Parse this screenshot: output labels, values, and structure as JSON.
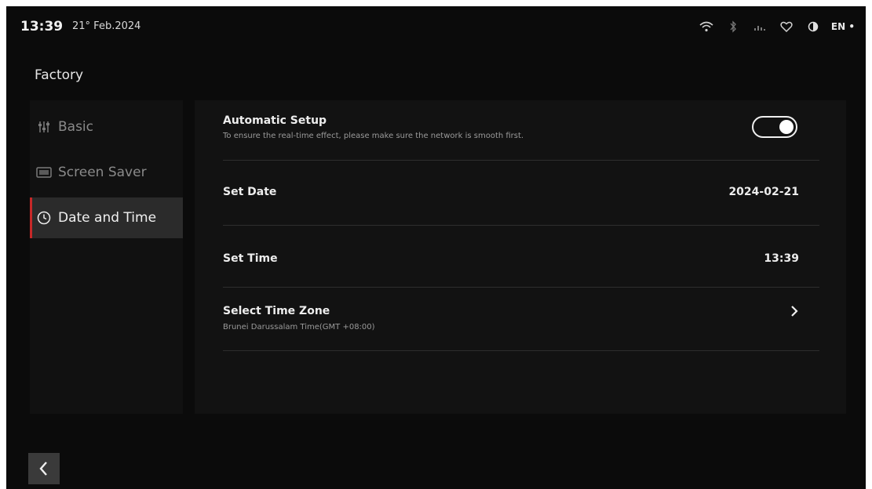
{
  "status_bar": {
    "time": "13:39",
    "date": "21° Feb.2024",
    "language": "EN",
    "icons": [
      "wifi-icon",
      "bluetooth-icon",
      "signal-icon",
      "heart-icon",
      "contrast-icon"
    ]
  },
  "page": {
    "title": "Factory"
  },
  "sidebar": {
    "items": [
      {
        "label": "Basic",
        "icon": "sliders-icon",
        "active": false
      },
      {
        "label": "Screen Saver",
        "icon": "screen-saver-icon",
        "active": false
      },
      {
        "label": "Date and Time",
        "icon": "clock-icon",
        "active": true
      }
    ]
  },
  "settings": {
    "automatic_setup": {
      "title": "Automatic Setup",
      "subtitle": "To ensure the real-time effect, please make sure the network is smooth first.",
      "enabled": true
    },
    "set_date": {
      "title": "Set Date",
      "value": "2024-02-21"
    },
    "set_time": {
      "title": "Set Time",
      "value": "13:39"
    },
    "time_zone": {
      "title": "Select Time Zone",
      "subtitle": "Brunei Darussalam Time(GMT +08:00)"
    }
  },
  "colors": {
    "background": "#0b0b0b",
    "panel": "#121212",
    "active_indicator": "#c62828",
    "text": "#ededed"
  }
}
